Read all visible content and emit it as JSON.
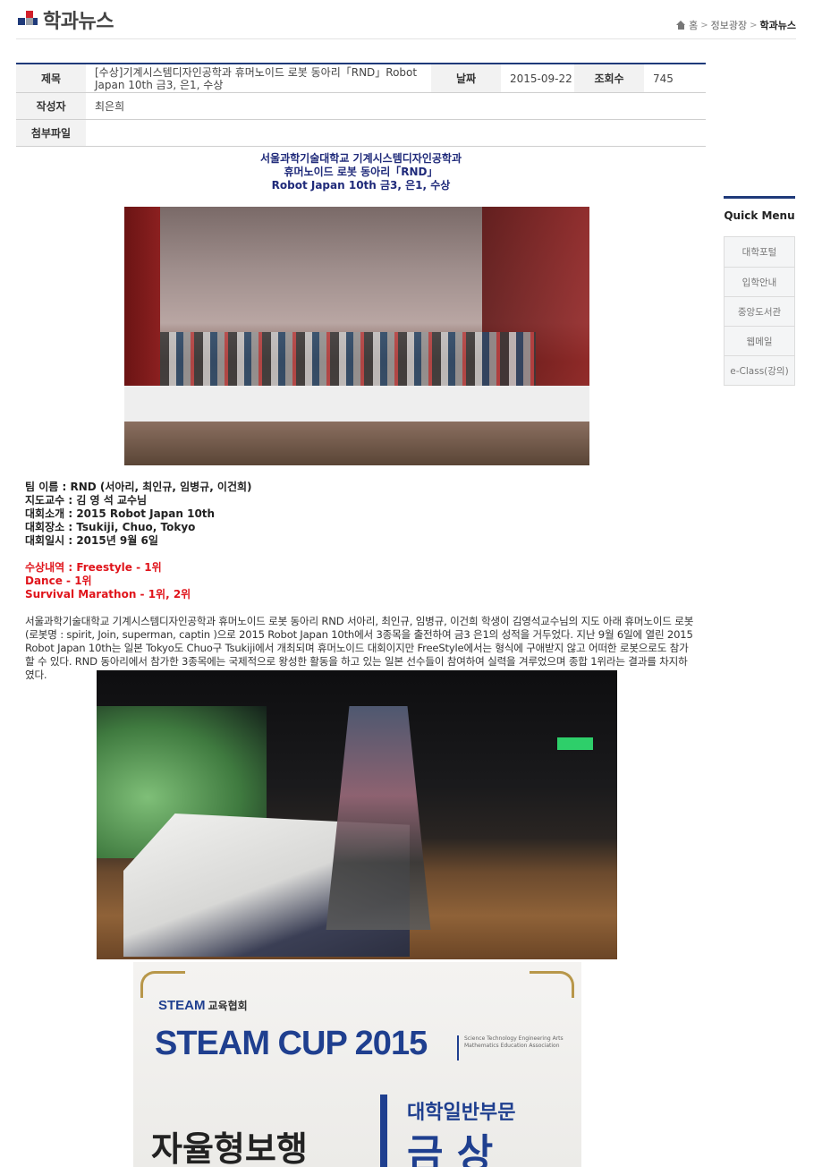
{
  "header": {
    "title": "학과뉴스",
    "breadcrumb": [
      "홈",
      "정보광장",
      "학과뉴스"
    ]
  },
  "info": {
    "subject_label": "제목",
    "subject": "[수상]기계시스템디자인공학과  휴머노이드  로봇  동아리「RND」Robot  Japan 10th 금3, 은1, 수상",
    "date_label": "날짜",
    "date": "2015-09-22",
    "views_label": "조회수",
    "views": "745",
    "author_label": "작성자",
    "author": "최은희",
    "attachment_label": "첨부파일",
    "attachment": ""
  },
  "content": {
    "heading": [
      "서울과학기술대학교 기계시스템디자인공학과",
      "휴머노이드 로봇 동아리「RND」",
      "Robot Japan 10th 금3, 은1, 수상"
    ],
    "details": [
      "팀 이름 : RND (서아리, 최인규, 임병규, 이건희)",
      "지도교수 : 김 영 석 교수님",
      "대회소개 : 2015 Robot Japan 10th",
      "대회장소 : Tsukiji, Chuo, Tokyo",
      "대회일시 : 2015년 9월 6일"
    ],
    "awards": [
      "수상내역 : Freestyle - 1위",
      "Dance - 1위",
      "Survival Marathon - 1위, 2위"
    ],
    "paragraph": "서울과학기술대학교 기계시스템디자인공학과 휴머노이드 로봇 동아리 RND 서아리, 최인규, 임병규, 이건희 학생이 김영석교수님의 지도 아래 휴머노이드 로봇(로봇명 : spirit, Join, superman, captin )으로 2015 Robot Japan 10th에서 3종목을 출전하여 금3 은1의 성적을 거두었다. 지난 9월 6일에 열린 2015 Robot Japan 10th는 일본 Tokyo도 Chuo구 Tsukiji에서 개최되며 휴머노이드 대회이지만 FreeStyle에서는 형식에 구애받지 않고 어떠한 로봇으로도 참가할 수 있다. RND 동아리에서 참가한 3종목에는 국제적으로 왕성한 활동을 하고 있는 일본 선수들이 참여하여 실력을 겨루었으며 종합 1위라는 결과를 차지하였다.",
    "certificate": {
      "brand": "STEAM",
      "brand_sub": "교육협회",
      "cup": "STEAM CUP",
      "year": "2015",
      "association": "Science Technology Engineering Arts Mathematics Education Association",
      "category": "대학일반부문",
      "event": "자율형보행",
      "prize": "금 상"
    }
  },
  "quick_menu": {
    "title": "Quick Menu",
    "items": [
      "대학포털",
      "입학안내",
      "중앙도서관",
      "웹메일",
      "e-Class(강의)"
    ]
  },
  "colors": {
    "brand_navy": "#1f3a7a",
    "brand_red": "#d21f2a",
    "award_red": "#e0141b"
  }
}
